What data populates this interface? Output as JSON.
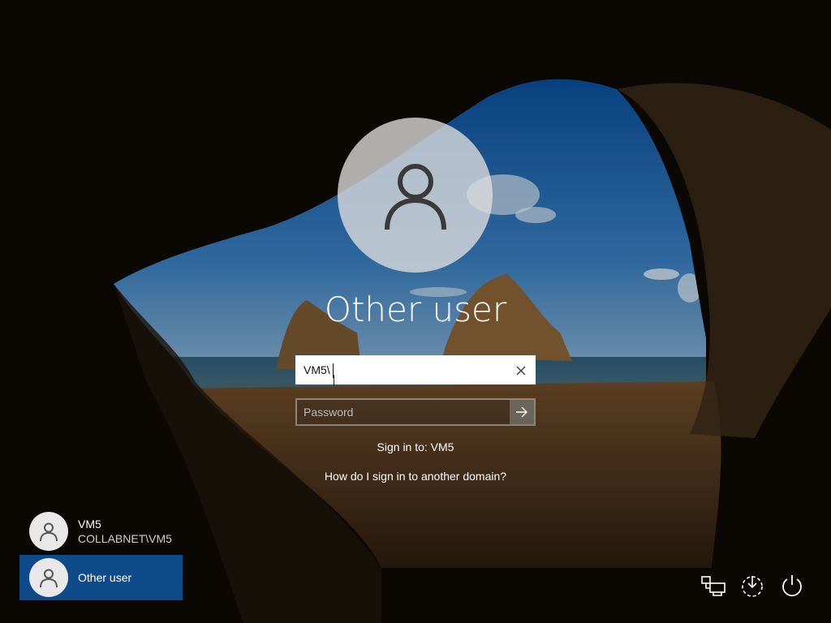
{
  "main": {
    "title": "Other user",
    "username_value": "VM5\\",
    "password_placeholder": "Password",
    "signin_to": "Sign in to: VM5",
    "domain_help_link": "How do I sign in to another domain?"
  },
  "user_list": [
    {
      "name": "VM5",
      "subtitle": "COLLABNET\\VM5",
      "icon": "user-icon"
    },
    {
      "name": "Other user",
      "icon": "user-icon",
      "selected": true
    }
  ],
  "system_icons": [
    "network-icon",
    "ease-of-access-icon",
    "power-icon"
  ],
  "colors": {
    "selected_tile": "#0f4a8a"
  }
}
